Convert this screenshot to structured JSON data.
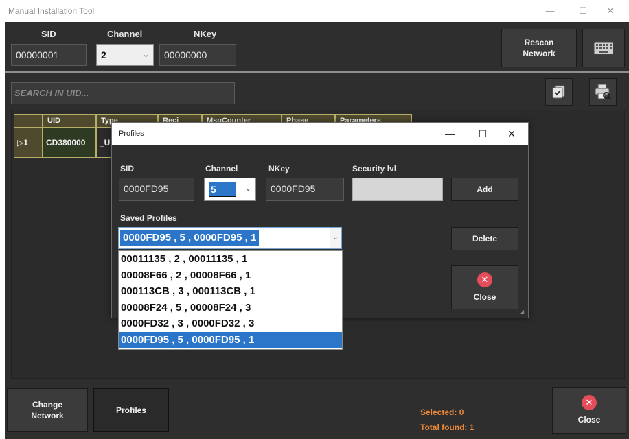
{
  "window": {
    "title": "Manual Installation Tool",
    "controls": {
      "minimize": "—",
      "maximize": "☐",
      "close": "✕"
    }
  },
  "toolbar": {
    "sid_label": "SID",
    "sid_value": "00000001",
    "channel_label": "Channel",
    "channel_value": "2",
    "nkey_label": "NKey",
    "nkey_value": "00000000",
    "rescan_line1": "Rescan",
    "rescan_line2": "Network",
    "keyboard_icon": "keyboard-icon"
  },
  "search": {
    "placeholder": "SEARCH IN UID..."
  },
  "grid": {
    "columns": [
      "UID",
      "Type",
      "Reci",
      "MsgCounter",
      "Phase",
      "Parameters"
    ],
    "rows": [
      {
        "index": "▷1",
        "uid": "CD380000",
        "type": "_U"
      }
    ]
  },
  "profiles_dialog": {
    "title": "Profiles",
    "controls": {
      "minimize": "—",
      "maximize": "☐",
      "close": "✕"
    },
    "sid_label": "SID",
    "sid_value": "0000FD95",
    "channel_label": "Channel",
    "channel_value": "5",
    "nkey_label": "NKey",
    "nkey_value": "0000FD95",
    "security_label": "Security lvl",
    "security_value": "",
    "add_label": "Add",
    "saved_profiles_label": "Saved Profiles",
    "selected_profile": "0000FD95 , 5 , 0000FD95 , 1",
    "delete_label": "Delete",
    "close_label": "Close",
    "profiles": [
      "00011135 , 2 , 00011135 , 1",
      "00008F66 , 2 , 00008F66 , 1",
      "000113CB , 3 , 000113CB , 1",
      "00008F24 , 5 , 00008F24 , 3",
      "0000FD32 , 3 , 0000FD32 , 3",
      "0000FD95 , 5 , 0000FD95 , 1"
    ]
  },
  "bottom": {
    "change_network_line1": "Change",
    "change_network_line2": "Network",
    "profiles_label": "Profiles",
    "selected": "Selected: 0",
    "total_found": "Total found: 1",
    "close_label": "Close"
  },
  "colors": {
    "background": "#2e2e2e",
    "grid_header": "#4f4a2e",
    "grid_border": "#b7ae6a",
    "selection": "#2b76c9",
    "status_text": "#e8873a",
    "close_red": "#e44d5a"
  }
}
